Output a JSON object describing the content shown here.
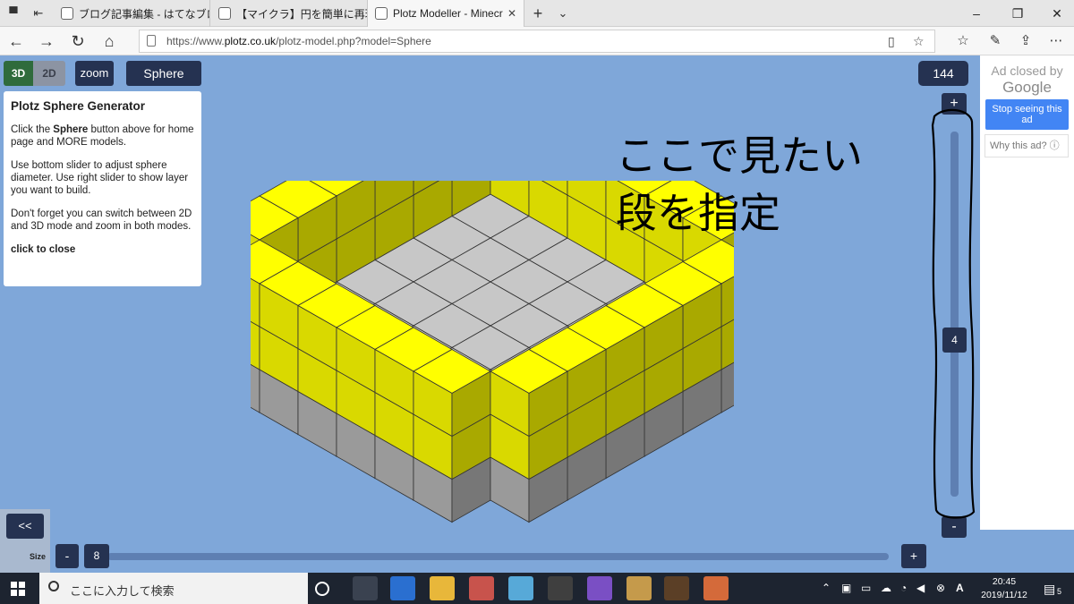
{
  "browser": {
    "tabs": [
      {
        "label": "ブログ記事編集 - はてなブログ"
      },
      {
        "label": "【マイクラ】円を簡単に再現でき‥"
      },
      {
        "label": "Plotz Modeller - Minecr"
      }
    ],
    "new_tab_label": "+",
    "url_prefix": "https://www.",
    "url_domain": "plotz.co.uk",
    "url_path": "/plotz-model.php?model=Sphere"
  },
  "toolbar": {
    "mode_3d": "3D",
    "mode_2d": "2D",
    "zoom": "zoom",
    "model": "Sphere",
    "block_count": "144"
  },
  "info_panel": {
    "title": "Plotz Sphere Generator",
    "p1_pre": "Click the ",
    "p1_bold": "Sphere",
    "p1_post": " button above for home page and MORE models.",
    "p2": "Use bottom slider to adjust sphere diameter. Use right slider to show layer you want to build.",
    "p3": "Don't forget you can switch between 2D and 3D mode and zoom in both modes.",
    "close": "click to close"
  },
  "annotation": "ここで見たい\n段を指定",
  "layer_slider": {
    "plus": "+",
    "minus": "-",
    "value": "4",
    "level_fraction": 0.55
  },
  "size_slider": {
    "label": "Size",
    "minus": "-",
    "plus": "+",
    "value": "8",
    "level_fraction": 0.0,
    "back": "<<"
  },
  "ad": {
    "closed_by": "Ad closed by",
    "google": "Google",
    "stop": "Stop seeing this ad",
    "why": "Why this ad? ⓘ"
  },
  "taskbar": {
    "search_placeholder": "ここに入力して検索",
    "time": "20:45",
    "date": "2019/11/12",
    "notification_count": "5"
  },
  "colors": {
    "page_bg": "#7fa7d9",
    "button_dark": "#253251",
    "mode_active": "#2f6b3c",
    "block_yellow": "#ffff00",
    "block_grey": "#bdbdbd"
  }
}
